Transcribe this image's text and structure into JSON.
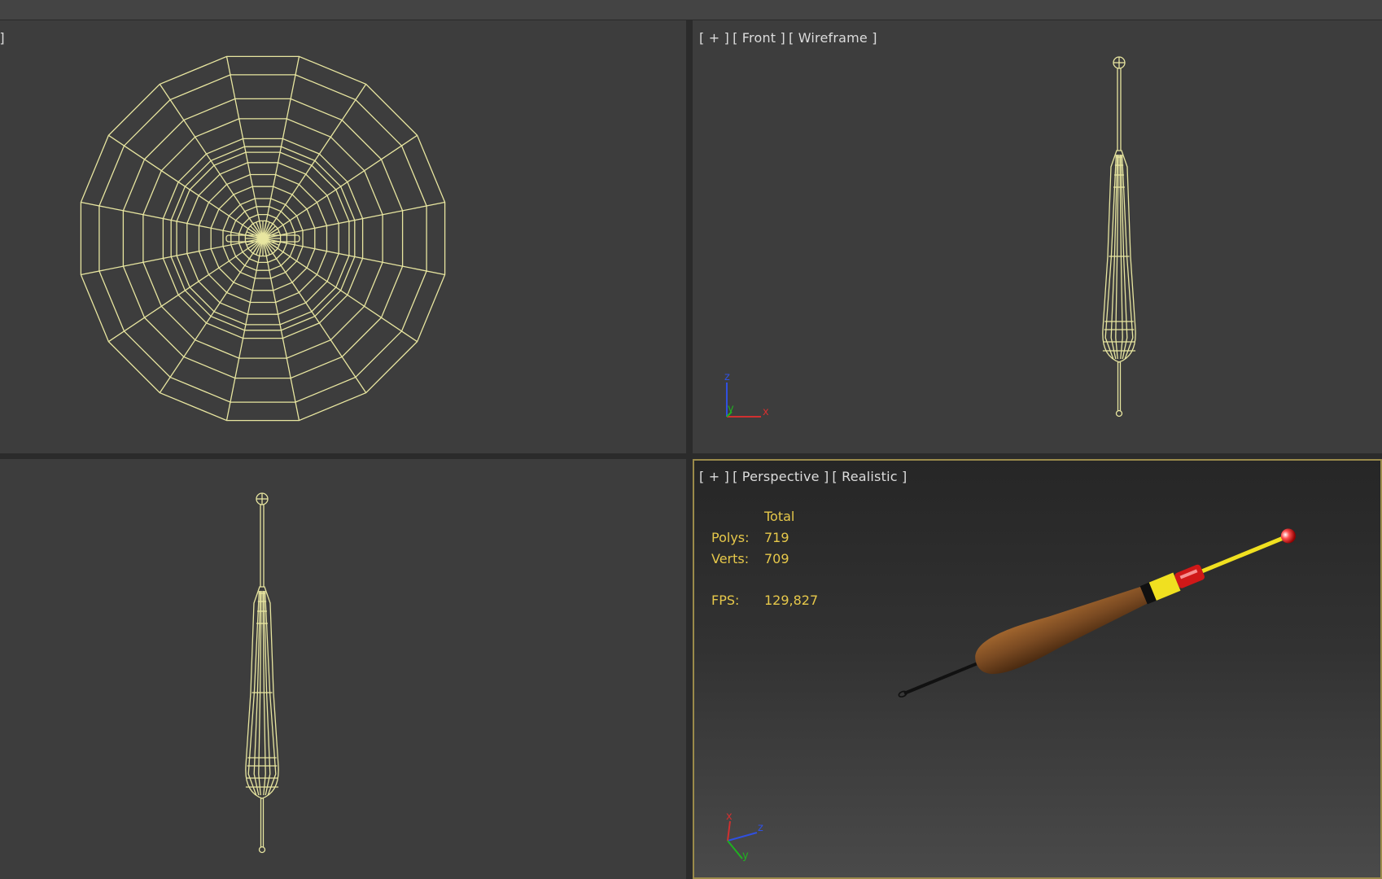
{
  "viewports": {
    "top": {
      "label_parts": [
        "e ]"
      ]
    },
    "front": {
      "label_parts": [
        "[ + ]",
        "[ Front ]",
        "[ Wireframe ]"
      ]
    },
    "left": {
      "label_parts": []
    },
    "perspective": {
      "label_parts": [
        "[ + ]",
        "[ Perspective ]",
        "[ Realistic ]"
      ]
    }
  },
  "stats": {
    "header": "Total",
    "polys_label": "Polys:",
    "polys_value": "719",
    "verts_label": "Verts:",
    "verts_value": "709",
    "fps_label": "FPS:",
    "fps_value": "129,827"
  },
  "axes": {
    "front": [
      "z",
      "y",
      "x"
    ],
    "perspective": [
      "z",
      "x",
      "y"
    ]
  },
  "colors": {
    "wire": "#e8e6a0",
    "stats": "#e6c84a",
    "active_border": "#9a8a4a",
    "body_brown": "#7a4a22",
    "band_yellow": "#f0e020",
    "band_red": "#d01818"
  }
}
